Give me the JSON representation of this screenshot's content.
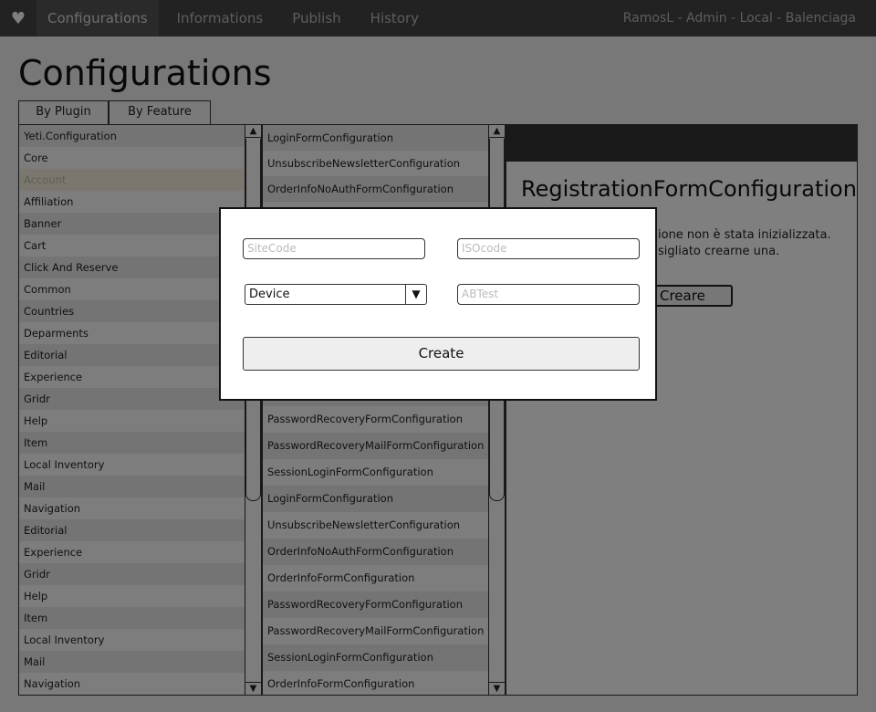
{
  "nav": {
    "logo_icon": "heart-icon",
    "items": [
      "Configurations",
      "Informations",
      "Publish",
      "History"
    ],
    "user": "RamosL - Admin - Local - Balenciaga"
  },
  "page": {
    "title": "Configurations"
  },
  "tabs": {
    "by_plugin": "By Plugin",
    "by_feature": "By Feature"
  },
  "left_list": {
    "items": [
      "Yeti.Configuration",
      "Core",
      "Account",
      "Affiliation",
      "Banner",
      "Cart",
      "Click And Reserve",
      "Common",
      "Countries",
      "Deparments",
      "Editorial",
      "Experience",
      "Gridr",
      "Help",
      "Item",
      "Local Inventory",
      "Mail",
      "Navigation",
      "Editorial",
      "Experience",
      "Gridr",
      "Help",
      "Item",
      "Local Inventory",
      "Mail",
      "Navigation"
    ],
    "selected_index": 2
  },
  "mid_list": {
    "items": [
      "LoginFormConfiguration",
      "UnsubscribeNewsletterConfiguration",
      "OrderInfoNoAuthFormConfiguration",
      "OrderInfoFormConfiguration",
      "PasswordRecoveryFormConfiguration",
      "PasswordRecoveryMailFormConfiguration",
      "SessionLoginFormConfiguration",
      "LoginFormConfiguration",
      "UnsubscribeNewsletterConfiguration",
      "OrderInfoNoAuthFormConfiguration",
      "OrderInfoFormConfiguration",
      "PasswordRecoveryFormConfiguration",
      "PasswordRecoveryMailFormConfiguration",
      "SessionLoginFormConfiguration",
      "LoginFormConfiguration",
      "UnsubscribeNewsletterConfiguration",
      "OrderInfoNoAuthFormConfiguration",
      "OrderInfoFormConfiguration",
      "PasswordRecoveryFormConfiguration",
      "PasswordRecoveryMailFormConfiguration",
      "SessionLoginFormConfiguration",
      "OrderInfoFormConfiguration"
    ]
  },
  "detail": {
    "title": "RegistrationFormConfiguration",
    "message_line1": "ione non è stata inizializzata.",
    "message_line2": "sigliato crearne una.",
    "create_label": "Creare"
  },
  "modal": {
    "sitecode_placeholder": "SiteCode",
    "isocode_placeholder": "ISOcode",
    "device_value": "Device",
    "abtest_placeholder": "ABTest",
    "create_label": "Create",
    "dropdown_icon": "triangle-down-icon"
  }
}
